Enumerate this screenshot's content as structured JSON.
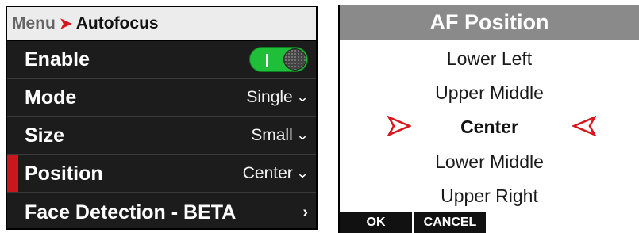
{
  "menu": {
    "breadcrumb": {
      "root": "Menu",
      "separator": "➤",
      "current": "Autofocus"
    },
    "rows": [
      {
        "label": "Enable",
        "toggle_state": "on"
      },
      {
        "label": "Mode",
        "value": "Single",
        "chevron": "⌄"
      },
      {
        "label": "Size",
        "value": "Small",
        "chevron": "⌄"
      },
      {
        "label": "Position",
        "value": "Center",
        "chevron": "⌄",
        "selected": true
      },
      {
        "label": "Face Detection - BETA",
        "chevron": "›"
      }
    ]
  },
  "af_dialog": {
    "title": "AF Position",
    "options": [
      "Lower Left",
      "Upper Middle",
      "Center",
      "Lower Middle",
      "Upper Right"
    ],
    "selected_option": "Center",
    "buttons": {
      "ok": "OK",
      "cancel": "CANCEL"
    }
  },
  "colors": {
    "accent_red": "#d9141b",
    "toggle_green": "#1fbf3a",
    "menu_background": "#1c1c1c",
    "dialog_title_gray": "#8a8a8a"
  }
}
